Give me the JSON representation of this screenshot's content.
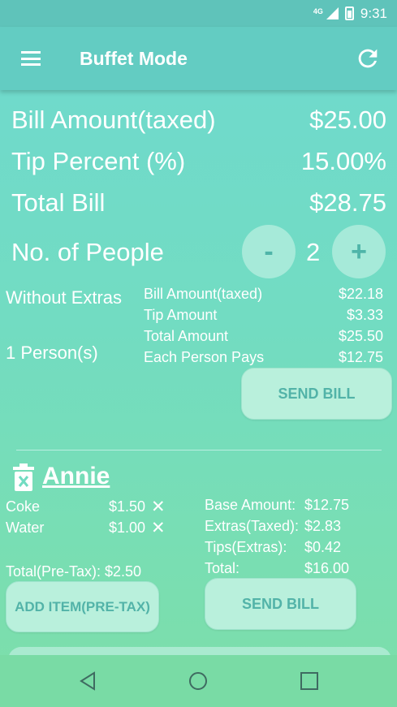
{
  "status_bar": {
    "network": "4G",
    "time": "9:31"
  },
  "app_bar": {
    "title": "Buffet Mode",
    "menu_icon": "menu-icon",
    "refresh_icon": "refresh-icon"
  },
  "summary": {
    "bill_amount_label": "Bill Amount(taxed)",
    "bill_amount_value": "$25.00",
    "tip_percent_label": "Tip Percent (%)",
    "tip_percent_value": "15.00%",
    "total_bill_label": "Total Bill",
    "total_bill_value": "$28.75",
    "people_label": "No. of People",
    "people_count": "2",
    "minus_label": "-",
    "plus_label": "+"
  },
  "without_extras": {
    "heading": "Without Extras",
    "persons_label": "1 Person(s)",
    "rows": [
      {
        "label": "Bill Amount(taxed)",
        "value": "$22.18"
      },
      {
        "label": "Tip Amount",
        "value": "$3.33"
      },
      {
        "label": "Total Amount",
        "value": "$25.50"
      },
      {
        "label": "Each Person Pays",
        "value": "$12.75"
      }
    ],
    "send_bill_label": "SEND BILL"
  },
  "person": {
    "name": "Annie",
    "items": [
      {
        "name": "Coke",
        "price": "$1.50",
        "remove": "✕"
      },
      {
        "name": "Water",
        "price": "$1.00",
        "remove": "✕"
      }
    ],
    "total_pretax": "Total(Pre-Tax): $2.50",
    "breakdown": [
      {
        "label": "Base Amount:",
        "value": "$12.75"
      },
      {
        "label": "Extras(Taxed):",
        "value": "$2.83"
      },
      {
        "label": "Tips(Extras):",
        "value": "$0.42"
      },
      {
        "label": "Total:",
        "value": "$16.00"
      }
    ],
    "add_item_label": "ADD ITEM(PRE-TAX)",
    "send_bill_label": "SEND BILL"
  },
  "colors": {
    "accent": "#63ccc2",
    "button_fill": "#b9f0dc",
    "button_text": "#52b3a8"
  }
}
